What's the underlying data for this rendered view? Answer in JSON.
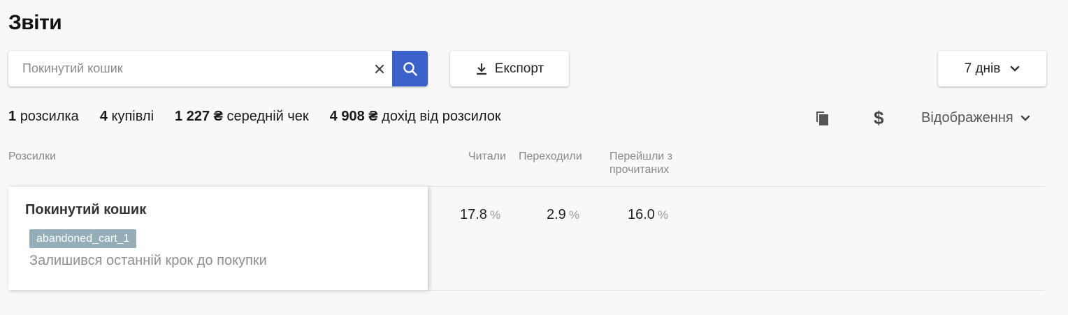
{
  "page": {
    "title": "Звіти"
  },
  "search": {
    "placeholder": "Покинутий кошик",
    "value": ""
  },
  "toolbar": {
    "export_label": "Експорт",
    "period_label": "7 днів"
  },
  "stats": [
    {
      "value": "1",
      "label": "розсилка"
    },
    {
      "value": "4",
      "label": "купівлі"
    },
    {
      "value": "1 227 ₴",
      "label": "середній чек"
    },
    {
      "value": "4 908 ₴",
      "label": "дохід від розсилок"
    }
  ],
  "tools": {
    "currency_symbol": "$",
    "view_label": "Відображення"
  },
  "table": {
    "headers": {
      "mailings": "Розсилки",
      "read": "Читали",
      "clicked": "Переходили",
      "conversion": "Перейшли з прочитаних"
    },
    "rows": [
      {
        "name": "Покинутий кошик",
        "tag": "abandoned_cart_1",
        "subject": "Залишився останній крок до покупки",
        "read": "17.8",
        "clicked": "2.9",
        "conversion": "16.0",
        "unit": "%"
      }
    ]
  },
  "colors": {
    "accent": "#3a62c8",
    "tag_bg": "#94aeb8"
  },
  "icons": [
    "clear-icon",
    "search-icon",
    "download-icon",
    "chevron-down-icon",
    "copy-icon",
    "dollar-icon"
  ]
}
